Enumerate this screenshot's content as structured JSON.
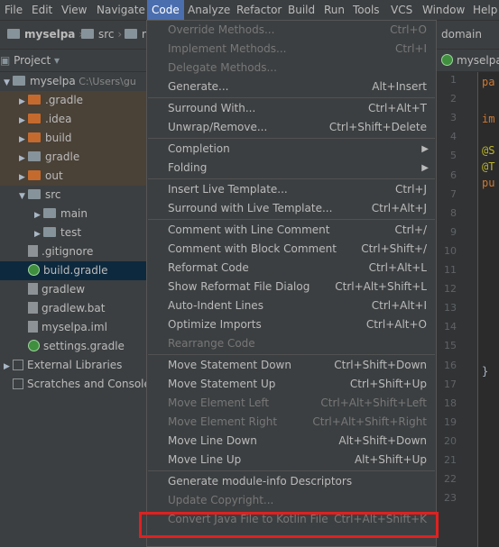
{
  "menubar": {
    "items": [
      "File",
      "Edit",
      "View",
      "Navigate",
      "Code",
      "Analyze",
      "Refactor",
      "Build",
      "Run",
      "Tools",
      "VCS",
      "Window",
      "Help"
    ],
    "active": "Code"
  },
  "navbar": {
    "crumbs": [
      "myselpa",
      "src",
      "m"
    ],
    "right_crumb": "domain"
  },
  "project_panel": {
    "title": "Project",
    "tree": [
      {
        "label": "myselpa",
        "note": "C:\\Users\\gu",
        "icon": "folder-icon",
        "expanded": true
      },
      {
        "label": ".gradle",
        "icon": "folder-icon",
        "expanded": false
      },
      {
        "label": ".idea",
        "icon": "folder-icon",
        "expanded": false
      },
      {
        "label": "build",
        "icon": "folder-icon",
        "expanded": false
      },
      {
        "label": "gradle",
        "icon": "folder-icon",
        "expanded": false
      },
      {
        "label": "out",
        "icon": "folder-icon",
        "expanded": false
      },
      {
        "label": "src",
        "icon": "folder-icon",
        "expanded": true
      },
      {
        "label": "main",
        "icon": "folder-icon",
        "expanded": false
      },
      {
        "label": "test",
        "icon": "folder-icon",
        "expanded": false
      },
      {
        "label": ".gitignore",
        "icon": "file-icon"
      },
      {
        "label": "build.gradle",
        "icon": "gradle-icon"
      },
      {
        "label": "gradlew",
        "icon": "file-icon"
      },
      {
        "label": "gradlew.bat",
        "icon": "file-icon"
      },
      {
        "label": "myselpa.iml",
        "icon": "file-icon"
      },
      {
        "label": "settings.gradle",
        "icon": "gradle-icon"
      },
      {
        "label": "External Libraries",
        "icon": "library-icon",
        "expanded": false
      },
      {
        "label": "Scratches and Consoles",
        "icon": "scratch-icon"
      }
    ]
  },
  "editor": {
    "tab_label": "myselpa",
    "line_numbers": [
      "1",
      "2",
      "3",
      "4",
      "5",
      "6",
      "7",
      "8",
      "9",
      "10",
      "11",
      "12",
      "13",
      "14",
      "15",
      "16",
      "17",
      "18",
      "19",
      "20",
      "21",
      "22",
      "23"
    ],
    "code_fragments": [
      "pa",
      "im",
      "@S",
      "@T",
      "pu",
      "}"
    ]
  },
  "code_menu": {
    "items": [
      {
        "label": "Override Methods...",
        "shortcut": "Ctrl+O",
        "enabled": false
      },
      {
        "label": "Implement Methods...",
        "shortcut": "Ctrl+I",
        "enabled": false
      },
      {
        "label": "Delegate Methods...",
        "shortcut": "",
        "enabled": false
      },
      {
        "label": "Generate...",
        "shortcut": "Alt+Insert",
        "enabled": true
      },
      {
        "separator": true
      },
      {
        "label": "Surround With...",
        "shortcut": "Ctrl+Alt+T",
        "enabled": true
      },
      {
        "label": "Unwrap/Remove...",
        "shortcut": "Ctrl+Shift+Delete",
        "enabled": true
      },
      {
        "separator": true
      },
      {
        "label": "Completion",
        "shortcut": "",
        "enabled": true,
        "submenu": true
      },
      {
        "label": "Folding",
        "shortcut": "",
        "enabled": true,
        "submenu": true
      },
      {
        "separator": true
      },
      {
        "label": "Insert Live Template...",
        "shortcut": "Ctrl+J",
        "enabled": true
      },
      {
        "label": "Surround with Live Template...",
        "shortcut": "Ctrl+Alt+J",
        "enabled": true
      },
      {
        "separator": true
      },
      {
        "label": "Comment with Line Comment",
        "shortcut": "Ctrl+/",
        "enabled": true
      },
      {
        "label": "Comment with Block Comment",
        "shortcut": "Ctrl+Shift+/",
        "enabled": true
      },
      {
        "label": "Reformat Code",
        "shortcut": "Ctrl+Alt+L",
        "enabled": true
      },
      {
        "label": "Show Reformat File Dialog",
        "shortcut": "Ctrl+Alt+Shift+L",
        "enabled": true
      },
      {
        "label": "Auto-Indent Lines",
        "shortcut": "Ctrl+Alt+I",
        "enabled": true
      },
      {
        "label": "Optimize Imports",
        "shortcut": "Ctrl+Alt+O",
        "enabled": true
      },
      {
        "label": "Rearrange Code",
        "shortcut": "",
        "enabled": false
      },
      {
        "separator": true
      },
      {
        "label": "Move Statement Down",
        "shortcut": "Ctrl+Shift+Down",
        "enabled": true
      },
      {
        "label": "Move Statement Up",
        "shortcut": "Ctrl+Shift+Up",
        "enabled": true
      },
      {
        "label": "Move Element Left",
        "shortcut": "Ctrl+Alt+Shift+Left",
        "enabled": false
      },
      {
        "label": "Move Element Right",
        "shortcut": "Ctrl+Alt+Shift+Right",
        "enabled": false
      },
      {
        "label": "Move Line Down",
        "shortcut": "Alt+Shift+Down",
        "enabled": true
      },
      {
        "label": "Move Line Up",
        "shortcut": "Alt+Shift+Up",
        "enabled": true
      },
      {
        "separator": true
      },
      {
        "label": "Generate module-info Descriptors",
        "shortcut": "",
        "enabled": true
      },
      {
        "label": "Update Copyright...",
        "shortcut": "",
        "enabled": false
      },
      {
        "label": "Convert Java File to Kotlin File",
        "shortcut": "Ctrl+Alt+Shift+K",
        "enabled": false,
        "highlighted": true
      }
    ]
  },
  "colors": {
    "menu_active": "#4b6eaf",
    "highlight_box": "#e02020",
    "panel_bg": "#3c3f41",
    "editor_bg": "#2b2b2b"
  }
}
